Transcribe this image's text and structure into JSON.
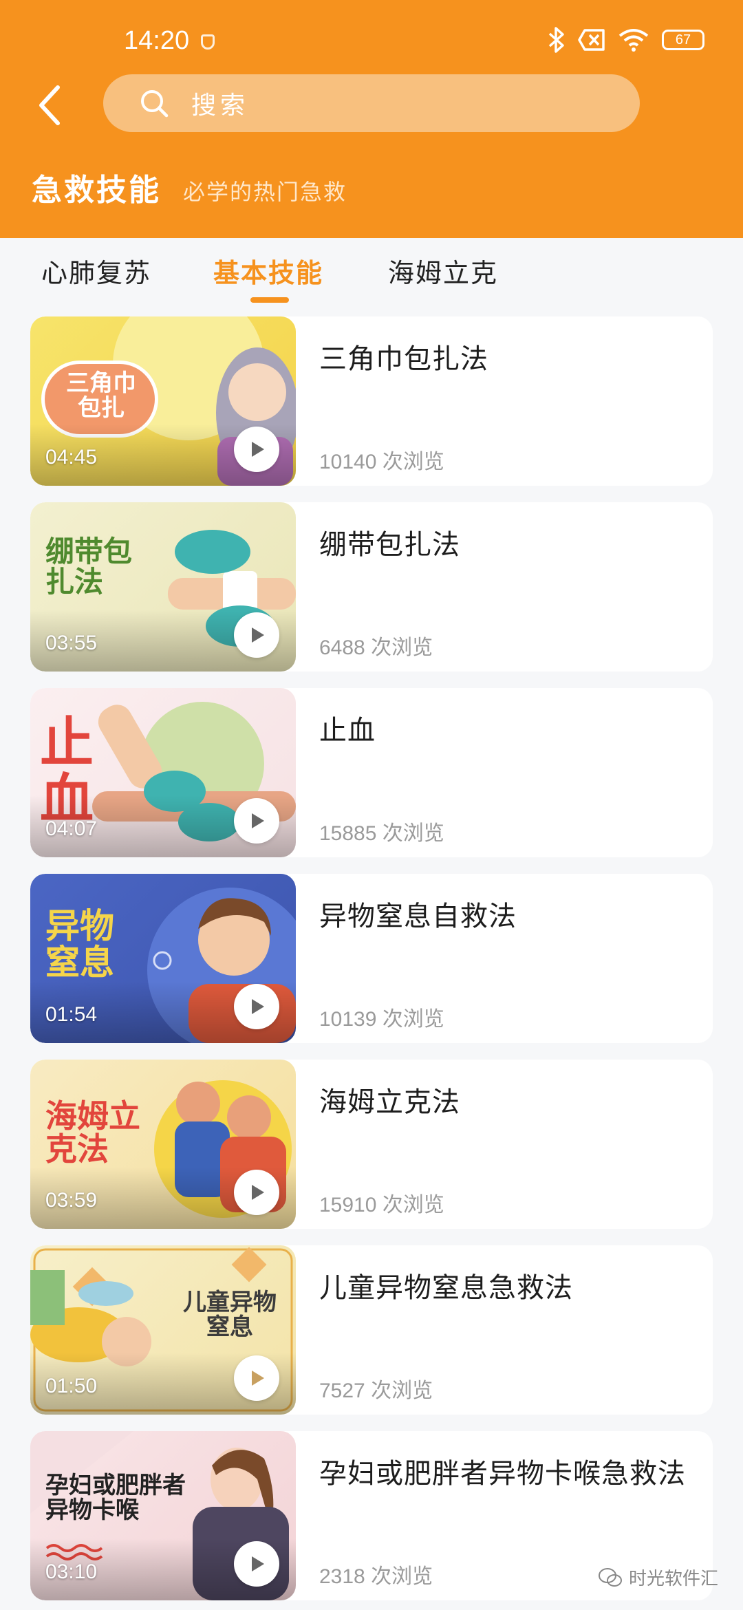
{
  "status_bar": {
    "time": "14:20",
    "battery": "67"
  },
  "search": {
    "placeholder": "搜索"
  },
  "section": {
    "title": "急救技能",
    "subtitle": "必学的热门急救"
  },
  "tabs": [
    {
      "label": "心肺复苏"
    },
    {
      "label": "基本技能"
    },
    {
      "label": "海姆立克"
    }
  ],
  "videos": [
    {
      "title": "三角巾包扎法",
      "views": "10140",
      "unit": "次浏览",
      "duration": "04:45",
      "cover_text": "三角巾包扎"
    },
    {
      "title": "绷带包扎法",
      "views": "6488",
      "unit": "次浏览",
      "duration": "03:55",
      "cover_text": "绷带包扎法"
    },
    {
      "title": "止血",
      "views": "15885",
      "unit": "次浏览",
      "duration": "04:07",
      "cover_text": "止血"
    },
    {
      "title": "异物窒息自救法",
      "views": "10139",
      "unit": "次浏览",
      "duration": "01:54",
      "cover_text": "异物窒息"
    },
    {
      "title": "海姆立克法",
      "views": "15910",
      "unit": "次浏览",
      "duration": "03:59",
      "cover_text": "海姆立克法"
    },
    {
      "title": "儿童异物窒息急救法",
      "views": "7527",
      "unit": "次浏览",
      "duration": "01:50",
      "cover_text": "儿童异物窒息"
    },
    {
      "title": "孕妇或肥胖者异物卡喉急救法",
      "views": "2318",
      "unit": "次浏览",
      "duration": "03:10",
      "cover_text": "孕妇或肥胖者异物卡喉"
    }
  ],
  "watermark": "时光软件汇",
  "colors": {
    "accent": "#f6921e",
    "search_bg": "#f8c07e"
  }
}
